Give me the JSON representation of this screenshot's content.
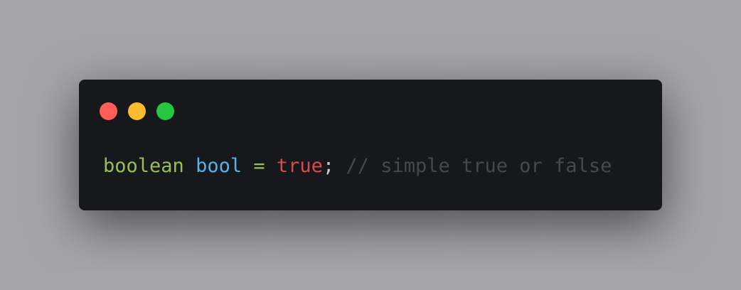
{
  "window": {
    "controls": [
      {
        "name": "close",
        "color": "#fe5e57"
      },
      {
        "name": "minimize",
        "color": "#fdbc2e"
      },
      {
        "name": "maximize",
        "color": "#24c73f"
      }
    ]
  },
  "code": {
    "type_keyword": "boolean",
    "variable": "bool",
    "operator": "=",
    "literal": "true",
    "terminator": ";",
    "comment": "// simple true or false"
  }
}
